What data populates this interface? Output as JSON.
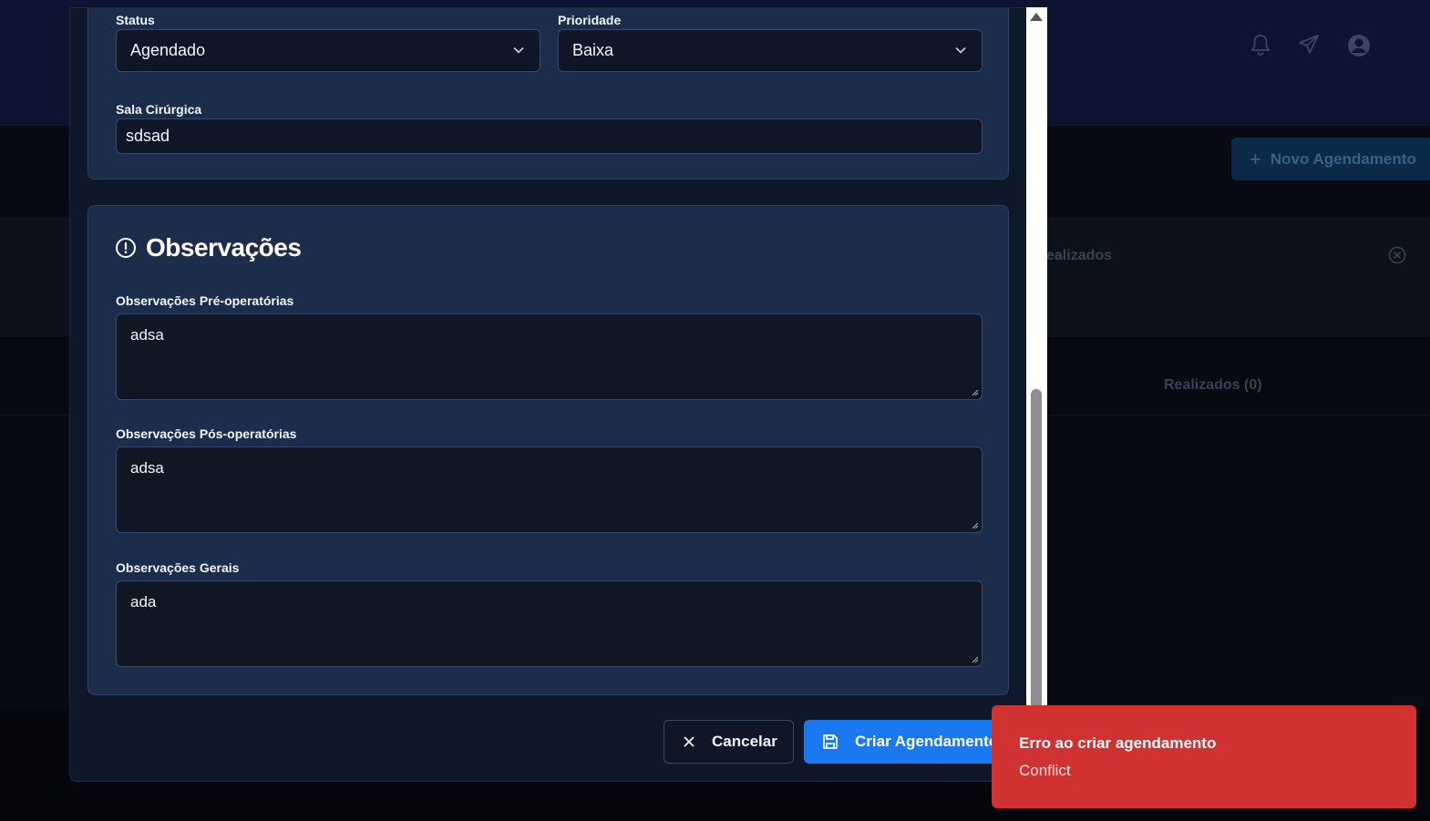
{
  "background": {
    "new_button_label": "Novo Agendamento",
    "filter_text": "ealizados",
    "tab_realizados": "Realizados (0)"
  },
  "modal": {
    "status_label": "Status",
    "status_value": "Agendado",
    "priority_label": "Prioridade",
    "priority_value": "Baixa",
    "room_label": "Sala Cirúrgica",
    "room_value": "sdsad",
    "obs_section_title": "Observações",
    "pre_op_label": "Observações Pré-operatórias",
    "pre_op_value": "adsa",
    "post_op_label": "Observações Pós-operatórias",
    "post_op_value": "adsa",
    "general_label": "Observações Gerais",
    "general_value": "ada",
    "cancel_label": "Cancelar",
    "create_label": "Criar Agendamento"
  },
  "toast": {
    "title": "Erro ao criar agendamento",
    "description": "Conflict",
    "color": "#d03131"
  },
  "colors": {
    "accent": "#1a78f0",
    "panel": "#1b2d4b"
  }
}
